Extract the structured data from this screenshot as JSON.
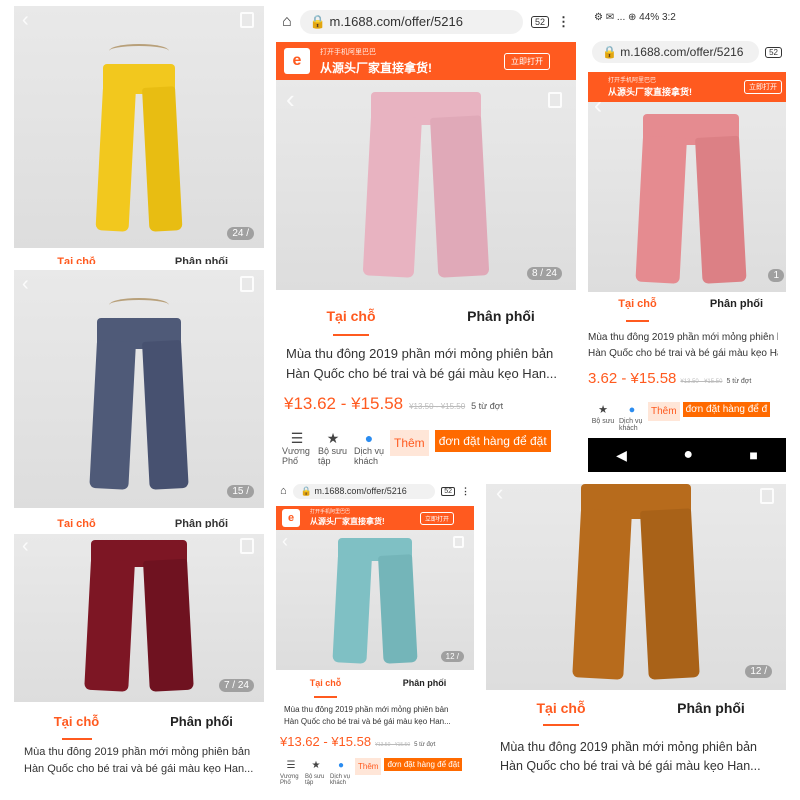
{
  "colors": {
    "accent": "#ff5a1f",
    "order_button": "#ff6a00",
    "add_button_bg": "#ffe6d8"
  },
  "common": {
    "tab_local": "Tại chỗ",
    "tab_distribution": "Phân phối",
    "title_line1": "Mùa thu đông 2019 phần mới mỏng phiên bản",
    "title_line2": "Hàn Quốc cho bé trai và bé gái màu kẹo Han...",
    "price": "¥13.62 - ¥15.58",
    "price_cut": "3.62 - ¥15.58",
    "old_price": "¥13.50 - ¥15.50",
    "moq": "5 từ đợt",
    "store_label": "Vương Phố",
    "store_label_cut": "Bộ sưu",
    "collection_label": "Bộ sưu tập",
    "service_label": "Dịch vụ khách",
    "add_label": "Thêm",
    "order_label": "đơn đặt hàng để đặt",
    "order_label_cut": "đơn đặt hàng để đ",
    "url": "m.1688.com/offer/5216",
    "banner_small": "打开手机阿里巴巴",
    "banner_big": "从源头厂家直接拿货!",
    "open_label": "立即打开",
    "tabs_count": "52"
  },
  "panels": {
    "yellow": {
      "color": "#f2c81e",
      "counter": "24 /"
    },
    "navy": {
      "color": "#4f5a78",
      "counter": "15 /"
    },
    "maroon": {
      "color": "#7d1624",
      "counter": "7 / 24"
    },
    "pink": {
      "color": "#e8b3c1",
      "counter": "8 / 24"
    },
    "salmon": {
      "color": "#e58b90",
      "counter": "1"
    },
    "teal": {
      "color": "#7fc0c4",
      "counter": "12 /"
    },
    "mustard": {
      "color": "#b76b1c",
      "counter": "12 /"
    }
  },
  "status_bar": {
    "text": "⚙ ✉ ... ⊕ 44% 3:2",
    "battery": "44%"
  },
  "icons": {
    "home": "home-icon",
    "lock": "lock-icon",
    "menu": "more-vert-icon",
    "back": "chevron-left-icon",
    "gallery": "gallery-icon",
    "store": "store-icon",
    "star": "star-icon",
    "chat": "chat-icon",
    "nav_back": "nav-back-icon",
    "nav_home": "nav-home-icon",
    "nav_recent": "nav-recent-icon"
  }
}
